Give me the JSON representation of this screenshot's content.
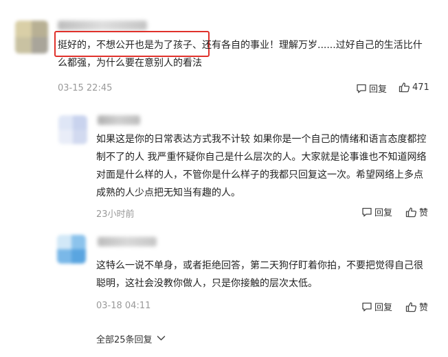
{
  "comments": [
    {
      "lines": [
        "挺好的，不想公开也是为了孩子、还有各自的事业！理解万岁......过好自己的生活比什",
        "么都强，为什么要在意别人的看法"
      ],
      "time": "03-15 22:45",
      "reply_label": "回复",
      "like_count": "471"
    },
    {
      "lines": [
        "如果这是你的日常表达方式我不计较 如果你是一个自己的情绪和语言态度都控",
        "制不了的人 我严重怀疑你自己是什么层次的人。大家就是论事谁也不知道网络",
        "对面是什么样的人，不管你是什么样子的我都只回复这一次。希望网络上多点",
        "成熟的人少点把无知当有趣的人。"
      ],
      "time": "23小时前",
      "reply_label": "回复",
      "like_label": "赞"
    },
    {
      "lines": [
        "这特么一说不单身，或者拒绝回答，第二天狗仔盯着你拍，不要把觉得自己很",
        "聪明，这社会没教你做人，只是你接触的层次太低。"
      ],
      "time": "03-18 04:11",
      "reply_label": "回复",
      "like_label": "赞"
    }
  ],
  "expand_label": "全部25条回复",
  "colors": {
    "highlight": "#e0302a",
    "meta": "#999999"
  },
  "icons": {
    "reply": "comment-bubble-icon",
    "like": "thumbs-up-icon",
    "expand": "chevron-down-icon"
  }
}
